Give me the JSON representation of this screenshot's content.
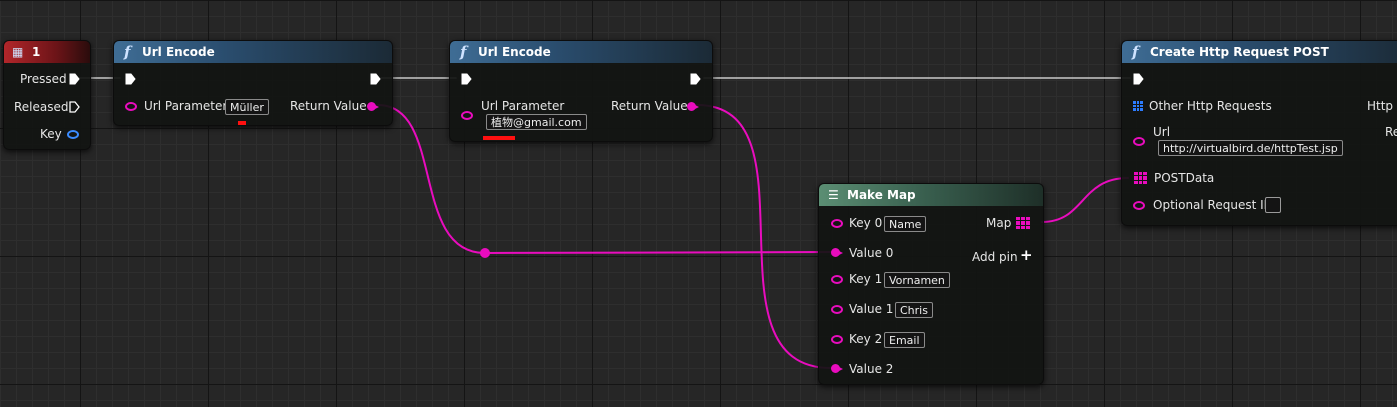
{
  "colors": {
    "data_wire": "#e90cbe",
    "exec_wire": "#c8c8c8",
    "struct_pin": "#3b8cff",
    "error": "#ff1010"
  },
  "event_node": {
    "title": "1",
    "icon": "keyboard-event-icon",
    "pins": {
      "pressed": "Pressed",
      "released": "Released",
      "key": "Key"
    }
  },
  "url_encode_1": {
    "title": "Url Encode",
    "icon": "function-icon",
    "param_label": "Url Parameter",
    "param_value": "Müller",
    "return_label": "Return Value"
  },
  "url_encode_2": {
    "title": "Url Encode",
    "icon": "function-icon",
    "param_label": "Url Parameter",
    "param_value": "植物@gmail.com",
    "return_label": "Return Value"
  },
  "make_map": {
    "title": "Make Map",
    "icon": "map-icon",
    "key0_label": "Key 0",
    "key0_value": "Name",
    "value0_label": "Value 0",
    "key1_label": "Key 1",
    "key1_value": "Vornamen",
    "value1_label": "Value 1",
    "value1_value": "Chris",
    "key2_label": "Key 2",
    "key2_value": "Email",
    "value2_label": "Value 2",
    "map_label": "Map",
    "add_pin_label": "Add pin"
  },
  "create_http": {
    "title": "Create Http Request POST",
    "icon": "function-icon",
    "other_label": "Other Http Requests",
    "url_label": "Url",
    "url_value": "http://virtualbird.de/httpTest.jsp",
    "postdata_label": "POSTData",
    "optional_label": "Optional Request ID",
    "right_out_1": "Http R",
    "right_out_2": "Rec"
  }
}
